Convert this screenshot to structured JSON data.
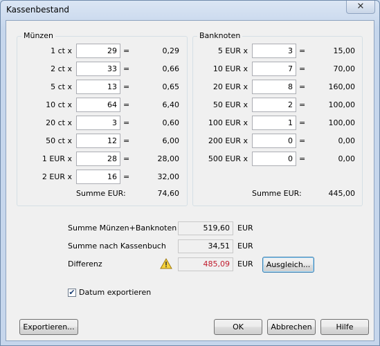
{
  "window": {
    "title": "Kassenbestand",
    "close_glyph": "✕"
  },
  "coins": {
    "title": "Münzen",
    "rows": [
      {
        "label": "1 ct x",
        "count": "29",
        "eq": "=",
        "value": "0,29"
      },
      {
        "label": "2 ct x",
        "count": "33",
        "eq": "=",
        "value": "0,66"
      },
      {
        "label": "5 ct x",
        "count": "13",
        "eq": "=",
        "value": "0,65"
      },
      {
        "label": "10 ct x",
        "count": "64",
        "eq": "=",
        "value": "6,40"
      },
      {
        "label": "20 ct x",
        "count": "3",
        "eq": "=",
        "value": "0,60"
      },
      {
        "label": "50 ct x",
        "count": "12",
        "eq": "=",
        "value": "6,00"
      },
      {
        "label": "1 EUR x",
        "count": "28",
        "eq": "=",
        "value": "28,00"
      },
      {
        "label": "2 EUR x",
        "count": "16",
        "eq": "=",
        "value": "32,00"
      }
    ],
    "sum_label": "Summe EUR:",
    "sum_value": "74,60"
  },
  "notes": {
    "title": "Banknoten",
    "rows": [
      {
        "label": "5 EUR x",
        "count": "3",
        "eq": "=",
        "value": "15,00"
      },
      {
        "label": "10 EUR x",
        "count": "7",
        "eq": "=",
        "value": "70,00"
      },
      {
        "label": "20 EUR x",
        "count": "8",
        "eq": "=",
        "value": "160,00"
      },
      {
        "label": "50 EUR x",
        "count": "2",
        "eq": "=",
        "value": "100,00"
      },
      {
        "label": "100 EUR x",
        "count": "1",
        "eq": "=",
        "value": "100,00"
      },
      {
        "label": "200 EUR x",
        "count": "0",
        "eq": "=",
        "value": "0,00"
      },
      {
        "label": "500 EUR x",
        "count": "0",
        "eq": "=",
        "value": "0,00"
      }
    ],
    "sum_label": "Summe EUR:",
    "sum_value": "445,00"
  },
  "totals": {
    "sum_all_label": "Summe Münzen+Banknoten",
    "sum_all_value": "519,60",
    "cashbook_label": "Summe nach Kassenbuch",
    "cashbook_value": "34,51",
    "diff_label": "Differenz",
    "diff_value": "485,09",
    "unit": "EUR",
    "balance_button": "Ausgleich...",
    "warning_icon": "warning-icon",
    "diff_color": "#c0192b"
  },
  "options": {
    "export_date_label": "Datum exportieren",
    "export_date_checked": true,
    "check_glyph": "✔"
  },
  "buttons": {
    "export": "Exportieren...",
    "ok": "OK",
    "cancel": "Abbrechen",
    "help": "Hilfe"
  }
}
